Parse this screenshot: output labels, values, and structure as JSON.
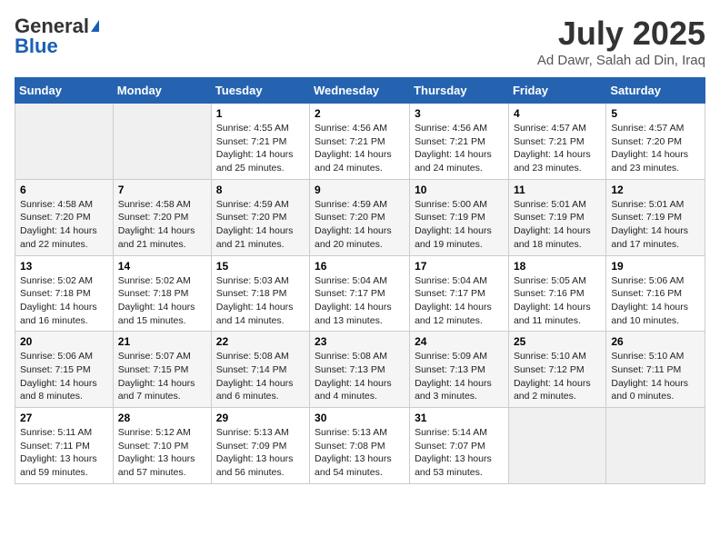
{
  "header": {
    "logo_general": "General",
    "logo_blue": "Blue",
    "month_title": "July 2025",
    "subtitle": "Ad Dawr, Salah ad Din, Iraq"
  },
  "days_of_week": [
    "Sunday",
    "Monday",
    "Tuesday",
    "Wednesday",
    "Thursday",
    "Friday",
    "Saturday"
  ],
  "weeks": [
    [
      {
        "day": "",
        "info": ""
      },
      {
        "day": "",
        "info": ""
      },
      {
        "day": "1",
        "info": "Sunrise: 4:55 AM\nSunset: 7:21 PM\nDaylight: 14 hours and 25 minutes."
      },
      {
        "day": "2",
        "info": "Sunrise: 4:56 AM\nSunset: 7:21 PM\nDaylight: 14 hours and 24 minutes."
      },
      {
        "day": "3",
        "info": "Sunrise: 4:56 AM\nSunset: 7:21 PM\nDaylight: 14 hours and 24 minutes."
      },
      {
        "day": "4",
        "info": "Sunrise: 4:57 AM\nSunset: 7:21 PM\nDaylight: 14 hours and 23 minutes."
      },
      {
        "day": "5",
        "info": "Sunrise: 4:57 AM\nSunset: 7:20 PM\nDaylight: 14 hours and 23 minutes."
      }
    ],
    [
      {
        "day": "6",
        "info": "Sunrise: 4:58 AM\nSunset: 7:20 PM\nDaylight: 14 hours and 22 minutes."
      },
      {
        "day": "7",
        "info": "Sunrise: 4:58 AM\nSunset: 7:20 PM\nDaylight: 14 hours and 21 minutes."
      },
      {
        "day": "8",
        "info": "Sunrise: 4:59 AM\nSunset: 7:20 PM\nDaylight: 14 hours and 21 minutes."
      },
      {
        "day": "9",
        "info": "Sunrise: 4:59 AM\nSunset: 7:20 PM\nDaylight: 14 hours and 20 minutes."
      },
      {
        "day": "10",
        "info": "Sunrise: 5:00 AM\nSunset: 7:19 PM\nDaylight: 14 hours and 19 minutes."
      },
      {
        "day": "11",
        "info": "Sunrise: 5:01 AM\nSunset: 7:19 PM\nDaylight: 14 hours and 18 minutes."
      },
      {
        "day": "12",
        "info": "Sunrise: 5:01 AM\nSunset: 7:19 PM\nDaylight: 14 hours and 17 minutes."
      }
    ],
    [
      {
        "day": "13",
        "info": "Sunrise: 5:02 AM\nSunset: 7:18 PM\nDaylight: 14 hours and 16 minutes."
      },
      {
        "day": "14",
        "info": "Sunrise: 5:02 AM\nSunset: 7:18 PM\nDaylight: 14 hours and 15 minutes."
      },
      {
        "day": "15",
        "info": "Sunrise: 5:03 AM\nSunset: 7:18 PM\nDaylight: 14 hours and 14 minutes."
      },
      {
        "day": "16",
        "info": "Sunrise: 5:04 AM\nSunset: 7:17 PM\nDaylight: 14 hours and 13 minutes."
      },
      {
        "day": "17",
        "info": "Sunrise: 5:04 AM\nSunset: 7:17 PM\nDaylight: 14 hours and 12 minutes."
      },
      {
        "day": "18",
        "info": "Sunrise: 5:05 AM\nSunset: 7:16 PM\nDaylight: 14 hours and 11 minutes."
      },
      {
        "day": "19",
        "info": "Sunrise: 5:06 AM\nSunset: 7:16 PM\nDaylight: 14 hours and 10 minutes."
      }
    ],
    [
      {
        "day": "20",
        "info": "Sunrise: 5:06 AM\nSunset: 7:15 PM\nDaylight: 14 hours and 8 minutes."
      },
      {
        "day": "21",
        "info": "Sunrise: 5:07 AM\nSunset: 7:15 PM\nDaylight: 14 hours and 7 minutes."
      },
      {
        "day": "22",
        "info": "Sunrise: 5:08 AM\nSunset: 7:14 PM\nDaylight: 14 hours and 6 minutes."
      },
      {
        "day": "23",
        "info": "Sunrise: 5:08 AM\nSunset: 7:13 PM\nDaylight: 14 hours and 4 minutes."
      },
      {
        "day": "24",
        "info": "Sunrise: 5:09 AM\nSunset: 7:13 PM\nDaylight: 14 hours and 3 minutes."
      },
      {
        "day": "25",
        "info": "Sunrise: 5:10 AM\nSunset: 7:12 PM\nDaylight: 14 hours and 2 minutes."
      },
      {
        "day": "26",
        "info": "Sunrise: 5:10 AM\nSunset: 7:11 PM\nDaylight: 14 hours and 0 minutes."
      }
    ],
    [
      {
        "day": "27",
        "info": "Sunrise: 5:11 AM\nSunset: 7:11 PM\nDaylight: 13 hours and 59 minutes."
      },
      {
        "day": "28",
        "info": "Sunrise: 5:12 AM\nSunset: 7:10 PM\nDaylight: 13 hours and 57 minutes."
      },
      {
        "day": "29",
        "info": "Sunrise: 5:13 AM\nSunset: 7:09 PM\nDaylight: 13 hours and 56 minutes."
      },
      {
        "day": "30",
        "info": "Sunrise: 5:13 AM\nSunset: 7:08 PM\nDaylight: 13 hours and 54 minutes."
      },
      {
        "day": "31",
        "info": "Sunrise: 5:14 AM\nSunset: 7:07 PM\nDaylight: 13 hours and 53 minutes."
      },
      {
        "day": "",
        "info": ""
      },
      {
        "day": "",
        "info": ""
      }
    ]
  ]
}
